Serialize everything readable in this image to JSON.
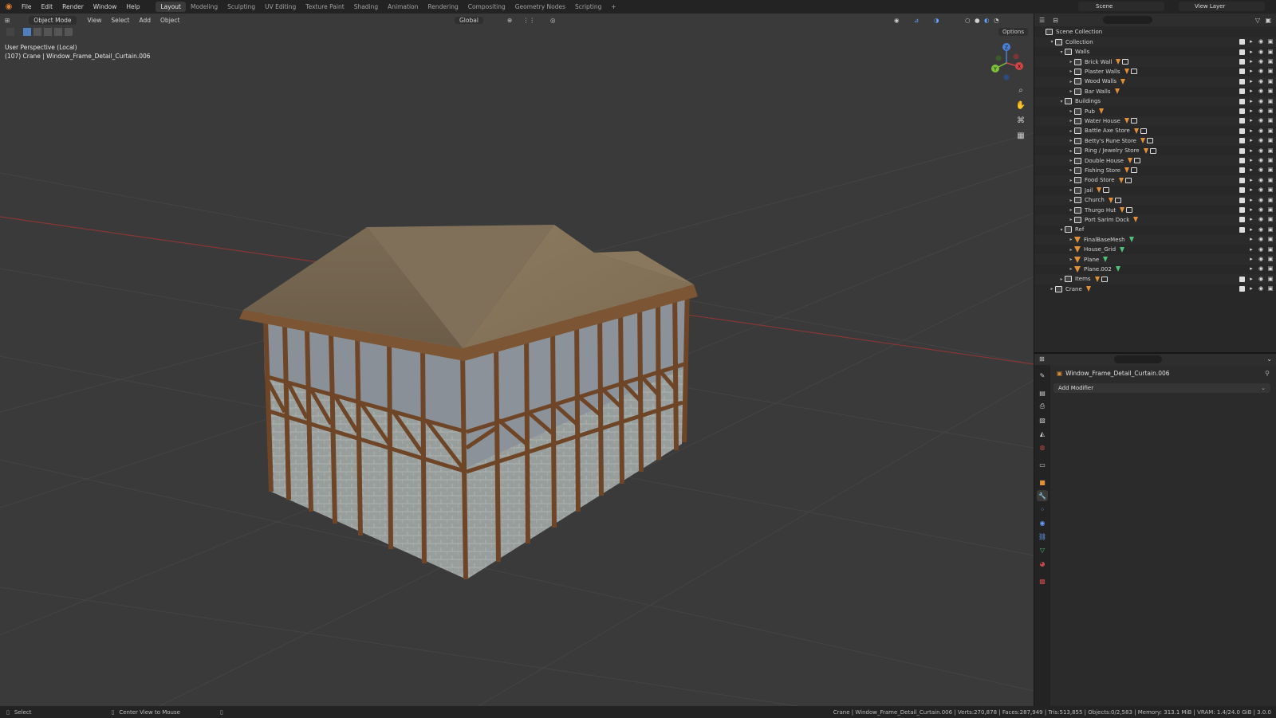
{
  "topbar": {
    "menus": [
      "File",
      "Edit",
      "Render",
      "Window",
      "Help"
    ],
    "workspaces": [
      "Layout",
      "Modeling",
      "Sculpting",
      "UV Editing",
      "Texture Paint",
      "Shading",
      "Animation",
      "Rendering",
      "Compositing",
      "Geometry Nodes",
      "Scripting"
    ],
    "active_workspace": "Layout",
    "add_tab": "+",
    "scene": "Scene",
    "view_layer": "View Layer"
  },
  "viewport": {
    "mode": "Object Mode",
    "menus": [
      "View",
      "Select",
      "Add",
      "Object"
    ],
    "transform_orientation": "Global",
    "options_label": "Options",
    "info_line1": "User Perspective (Local)",
    "info_line2": "(107) Crane | Window_Frame_Detail_Curtain.006",
    "gizmo_axes": {
      "x": "X",
      "y": "Y",
      "z": "Z"
    },
    "colors": {
      "background": "#3a3a3a",
      "grid": "#474747",
      "x_axis": "#9a3b3b",
      "roof": "#8a7458",
      "frame": "#6e4526",
      "glass": "#8c9198",
      "stone": "#9aa1a0"
    }
  },
  "outliner": {
    "scene_collection": "Scene Collection",
    "rows": [
      {
        "label": "Collection",
        "depth": 1,
        "kind": "collection",
        "badge": ""
      },
      {
        "label": "Walls",
        "depth": 2,
        "kind": "collection",
        "badge": ""
      },
      {
        "label": "Brick Wall",
        "depth": 3,
        "kind": "collection",
        "badge": "mesh-box"
      },
      {
        "label": "Plaster Walls",
        "depth": 3,
        "kind": "collection",
        "badge": "mesh-box"
      },
      {
        "label": "Wood Walls",
        "depth": 3,
        "kind": "collection",
        "badge": "mesh"
      },
      {
        "label": "Bar Walls",
        "depth": 3,
        "kind": "collection",
        "badge": "mesh"
      },
      {
        "label": "Buildings",
        "depth": 2,
        "kind": "collection",
        "badge": ""
      },
      {
        "label": "Pub",
        "depth": 3,
        "kind": "collection",
        "badge": "mesh"
      },
      {
        "label": "Water House",
        "depth": 3,
        "kind": "collection",
        "badge": "mesh-box"
      },
      {
        "label": "Battle Axe Store",
        "depth": 3,
        "kind": "collection",
        "badge": "mesh-box"
      },
      {
        "label": "Betty's Rune Store",
        "depth": 3,
        "kind": "collection",
        "badge": "mesh-box"
      },
      {
        "label": "Ring / Jewelry Store",
        "depth": 3,
        "kind": "collection",
        "badge": "mesh-box"
      },
      {
        "label": "Double House",
        "depth": 3,
        "kind": "collection",
        "badge": "mesh-box"
      },
      {
        "label": "Fishing Store",
        "depth": 3,
        "kind": "collection",
        "badge": "mesh-box"
      },
      {
        "label": "Food Store",
        "depth": 3,
        "kind": "collection",
        "badge": "mesh-box"
      },
      {
        "label": "Jail",
        "depth": 3,
        "kind": "collection",
        "badge": "mesh-box"
      },
      {
        "label": "Church",
        "depth": 3,
        "kind": "collection",
        "badge": "mesh-box"
      },
      {
        "label": "Thurgo Hut",
        "depth": 3,
        "kind": "collection",
        "badge": "mesh-box"
      },
      {
        "label": "Port Sarim Dock",
        "depth": 3,
        "kind": "collection",
        "badge": "mesh"
      },
      {
        "label": "Ref",
        "depth": 2,
        "kind": "collection",
        "badge": ""
      },
      {
        "label": "FinalBaseMesh",
        "depth": 3,
        "kind": "mesh",
        "badge": "green"
      },
      {
        "label": "House_Grid",
        "depth": 3,
        "kind": "mesh",
        "badge": "green"
      },
      {
        "label": "Plane",
        "depth": 3,
        "kind": "mesh",
        "badge": "green"
      },
      {
        "label": "Plane.002",
        "depth": 3,
        "kind": "mesh",
        "badge": "green"
      },
      {
        "label": "Items",
        "depth": 2,
        "kind": "collection",
        "badge": "mesh-box"
      },
      {
        "label": "Crane",
        "depth": 1,
        "kind": "collection",
        "badge": "mesh"
      }
    ]
  },
  "properties": {
    "object_name": "Window_Frame_Detail_Curtain.006",
    "add_modifier": "Add Modifier"
  },
  "statusbar": {
    "left_action": "Select",
    "middle_action": "Center View to Mouse",
    "stats": "Crane | Window_Frame_Detail_Curtain.006 | Verts:270,878 | Faces:287,949 | Tris:513,855 | Objects:0/2,583 | Memory: 313.1 MiB | VRAM: 1.4/24.0 GiB | 3.0.0"
  }
}
